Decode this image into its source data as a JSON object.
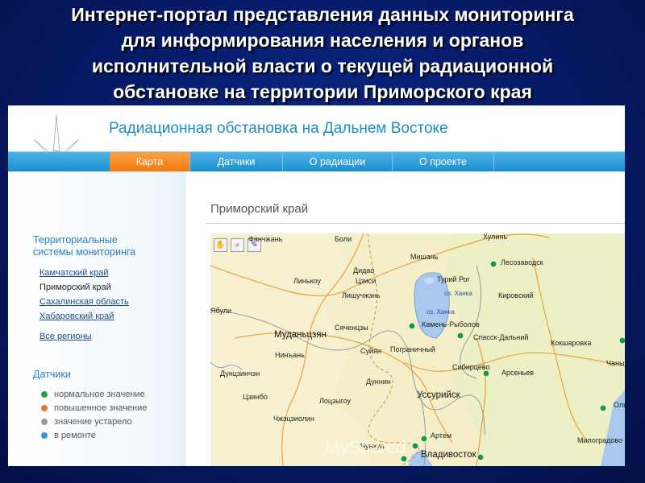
{
  "slide_title": [
    "Интернет-портал представления данных мониторинга",
    "для информирования населения и органов",
    "исполнительной власти о текущей радиационной",
    "обстановке на территории Приморского края"
  ],
  "site_title": "Радиационная обстановка на Дальнем Востоке",
  "nav": [
    {
      "label": "Карта",
      "active": true
    },
    {
      "label": "Датчики",
      "active": false
    },
    {
      "label": "О радиации",
      "active": false
    },
    {
      "label": "О проекте",
      "active": false
    }
  ],
  "sidebar": {
    "systems_heading_line1": "Территориальные",
    "systems_heading_line2": "системы мониторинга",
    "regions": [
      "Камчатский край",
      "Приморский край",
      "Сахалинская область",
      "Хабаровский край"
    ],
    "all_regions": "Все регионы",
    "sensors_heading": "Датчики",
    "legend": [
      {
        "label": "нормальное значение",
        "color": "#2e9e3e"
      },
      {
        "label": "повышенное значение",
        "color": "#e07a2a"
      },
      {
        "label": "значение устарело",
        "color": "#999999"
      },
      {
        "label": "в ремонте",
        "color": "#2a9ad8"
      }
    ]
  },
  "content_title": "Приморский край",
  "map": {
    "tools": [
      "hand-tool-icon",
      "zoom-tool-icon",
      "ruler-tool-icon"
    ],
    "labels": [
      "Фанчжань",
      "Боли",
      "Хулинь",
      "Лесозаводск",
      "Мишань",
      "Дидао",
      "Линькоу",
      "Цзиси",
      "Турий Рог",
      "оз. Ханка",
      "оз. Ханка",
      "Лишучжэнь",
      "Кировский",
      "Ябули",
      "Камень-Рыболов",
      "Спасск-Дальний",
      "Муданьцзян",
      "Сяченцзы",
      "Кокшаровка",
      "Нинъань",
      "Суйян",
      "Пограничный",
      "Сибирцево",
      "Арсеньев",
      "Чаны",
      "Дуннин",
      "Уссурийск",
      "Дунцзинчэн",
      "Цзинбо",
      "Лоцзыгоу",
      "Чжэцзиолин",
      "Артем",
      "Чунхуа",
      "Владивосток",
      "Милоградово",
      "Ольга"
    ],
    "station_color": "#1a9a3a"
  },
  "watermark": "MyShared"
}
